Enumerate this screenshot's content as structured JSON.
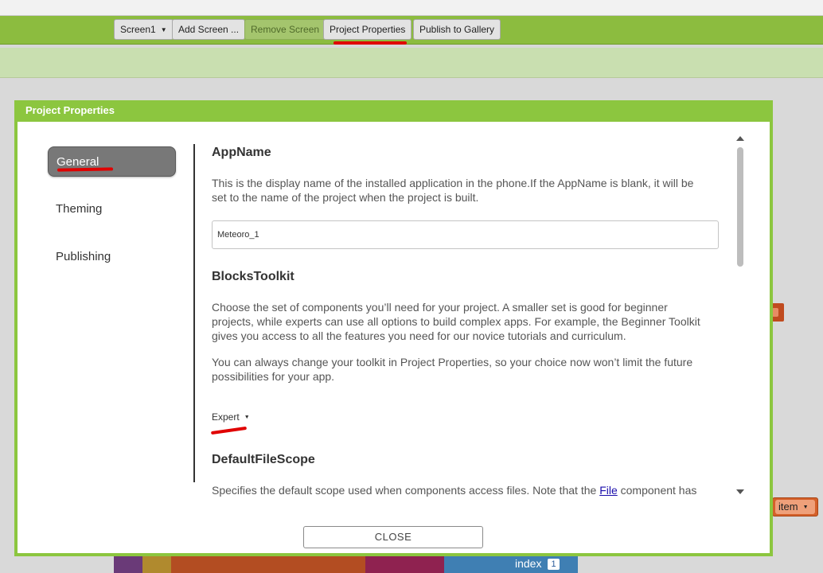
{
  "toolbar": {
    "screen_label": "Screen1",
    "add_screen_label": "Add Screen ...",
    "remove_screen_label": "Remove Screen",
    "project_properties_label": "Project Properties",
    "publish_label": "Publish to Gallery"
  },
  "workspace": {
    "item_block_label": "item",
    "index_block_label": "index",
    "index_value": "1"
  },
  "dialog": {
    "title": "Project Properties",
    "nav": {
      "general": "General",
      "theming": "Theming",
      "publishing": "Publishing"
    },
    "properties": {
      "app_name": {
        "title": "AppName",
        "description": "This is the display name of the installed application in the phone.If the AppName is blank, it will be set to the name of the project when the project is built.",
        "value": "Meteoro_1"
      },
      "blocks_toolkit": {
        "title": "BlocksToolkit",
        "description_1": "Choose the set of components you’ll need for your project. A smaller set is good for beginner projects, while experts can use all options to build complex apps. For example, the Beginner Toolkit gives you access to all the features you need for our novice tutorials and curriculum.",
        "description_2": "You can always change your toolkit in Project Properties, so your choice now won’t limit the future possibilities for your app.",
        "selected": "Expert"
      },
      "default_file_scope": {
        "title": "DefaultFileScope",
        "description_start": "Specifies the default scope used when components access files. Note that the ",
        "link_text": "File",
        "description_end": " component has its own property for controlling file scope."
      }
    },
    "close_label": "CLOSE"
  },
  "colors": {
    "dialog_border": "#8cc63f",
    "toolbar": "#8cbc3f",
    "nav_selected": "#787878",
    "annotation": "#e00000"
  }
}
